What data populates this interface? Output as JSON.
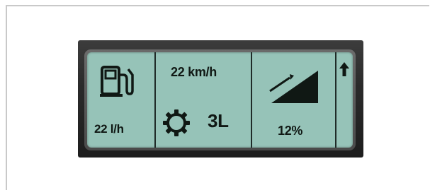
{
  "display": {
    "fuel": {
      "icon": "fuel-pump-icon",
      "consumption": "22 l/h"
    },
    "speed": {
      "value": "22 km/h"
    },
    "gear": {
      "icon": "gear-icon",
      "value": "3L"
    },
    "incline": {
      "icon": "incline-slope-icon",
      "value": "12%"
    },
    "shift": {
      "icon": "arrow-up-icon"
    }
  },
  "colors": {
    "screen": "#96c3b8",
    "ink": "#101814",
    "bezel": "#4a4a4a",
    "housing": "#2a2a2a"
  }
}
